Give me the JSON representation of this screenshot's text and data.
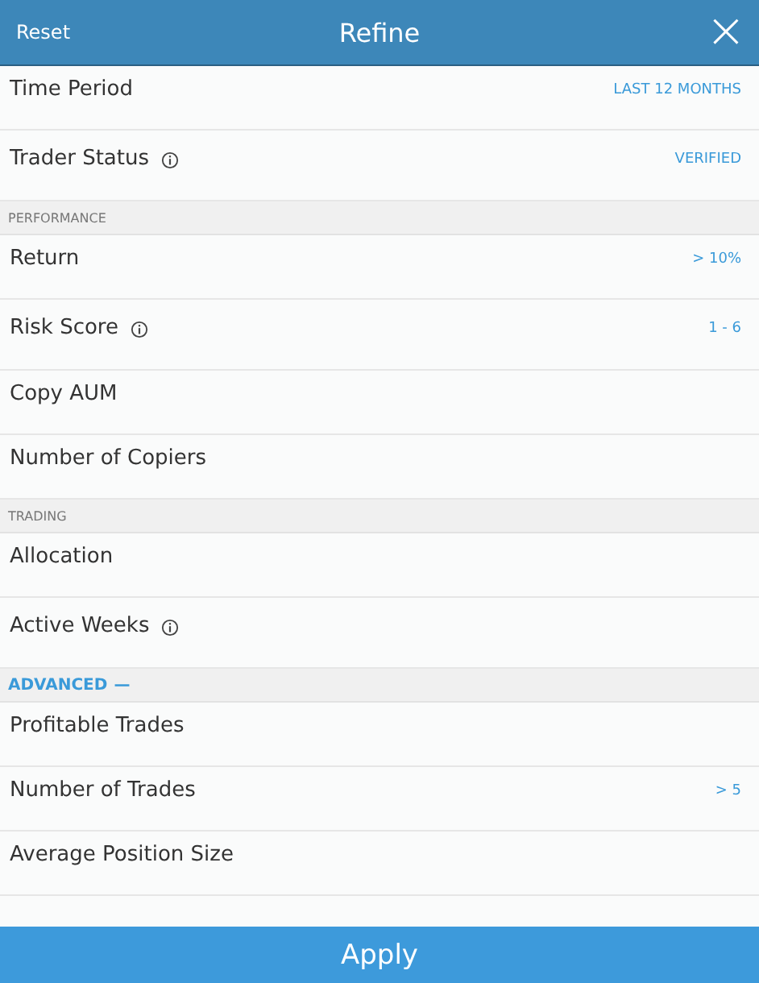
{
  "header": {
    "reset": "Reset",
    "title": "Refine",
    "close": "×"
  },
  "sections": [
    {
      "items": [
        {
          "label": "Time Period",
          "info": false,
          "value": "LAST 12 MONTHS"
        },
        {
          "label": "Trader Status",
          "info": true,
          "value": "VERIFIED"
        }
      ]
    },
    {
      "kind": "plain",
      "title": "PERFORMANCE",
      "items": [
        {
          "label": "Return",
          "info": false,
          "value": "> 10%"
        },
        {
          "label": "Risk Score",
          "info": true,
          "value": "1 - 6"
        },
        {
          "label": "Copy AUM",
          "info": false
        },
        {
          "label": "Number of Copiers",
          "info": false
        }
      ]
    },
    {
      "kind": "plain",
      "title": "TRADING",
      "items": [
        {
          "label": "Allocation",
          "info": false
        },
        {
          "label": "Active Weeks",
          "info": true
        }
      ]
    },
    {
      "kind": "toggle",
      "title": "ADVANCED",
      "toggle": "—",
      "items": [
        {
          "label": "Profitable Trades",
          "info": false
        },
        {
          "label": "Number of Trades",
          "info": false,
          "value": "> 5"
        },
        {
          "label": "Average Position Size",
          "info": false
        }
      ]
    }
  ],
  "apply": "Apply"
}
